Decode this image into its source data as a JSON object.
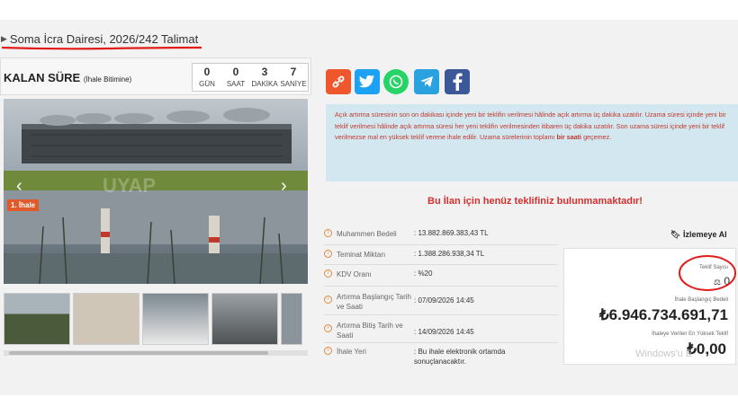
{
  "breadcrumb": {
    "text": "Soma İcra Dairesi, 2026/242 Talimat"
  },
  "timer": {
    "title": "KALAN SÜRE",
    "subtitle": "(İhale Bitimine)",
    "units": [
      {
        "value": "0",
        "label": "GÜN"
      },
      {
        "value": "0",
        "label": "SAAT"
      },
      {
        "value": "3",
        "label": "DAKİKA"
      },
      {
        "value": "7",
        "label": "SANİYE"
      }
    ]
  },
  "gallery": {
    "badge": "1. İhale",
    "watermark": "UYAP"
  },
  "share": {
    "icons": [
      "link-icon",
      "twitter-icon",
      "whatsapp-icon",
      "telegram-icon",
      "facebook-icon"
    ],
    "colors": {
      "link": "#f0562c",
      "twitter": "#1da1f2",
      "whatsapp": "#25d366",
      "telegram": "#2aa2df",
      "facebook": "#3b5998"
    }
  },
  "info": {
    "line1": "Açık artırma süresinin son on dakikası içinde yeni bir teklifin verilmesi hâlinde açık artırma üç dakika uzatılır. Uzama süresi içinde yeni bir teklif verilmesi hâlinde açık artırma süresi her yeni teklifin verilmesinden itibaren üç dakika uzatılır. Son uzama süresi içinde yeni bir teklif verilmezse mal en yüksek teklif verene ihale edilir. Uzama sürelerinin toplamı",
    "bold": "bir saati",
    "line2": "geçemez."
  },
  "no_bid_message": "Bu İlan için henüz teklifiniz bulunmamaktadır!",
  "details": [
    {
      "label": "Muhammen Bedeli",
      "value": ":   13.882.869.383,43 TL"
    },
    {
      "label": "Teminat Miktarı",
      "value": ":   1.388.286.938,34 TL"
    },
    {
      "label": "KDV Oranı",
      "value": ":   %20"
    },
    {
      "label": "Artırma Başlangıç Tarih ve Saati",
      "value": ":   07/09/2026 14:45"
    },
    {
      "label": "Artırma Bitiş Tarih ve Saati",
      "value": ":   14/09/2026 14:45"
    },
    {
      "label": "İhale Yeri",
      "value": ":   Bu ihale elektronik ortamda sonuçlanacaktır."
    }
  ],
  "watch_label": "İzlemeye Al",
  "bid_card": {
    "count_label": "Teklif Sayısı",
    "count": "0",
    "start_label": "İhale Başlangıç Bedeli",
    "start_value": "₺6.946.734.691,71",
    "highest_label": "İhaleye Verilen En Yüksek Teklif",
    "highest_value": "₺0,00"
  },
  "watermark_os": "Windows'u E",
  "accent": {
    "red_markup": "#e21b1b",
    "warning_red": "#d32f2f",
    "info_bg": "#d3e7f1"
  }
}
